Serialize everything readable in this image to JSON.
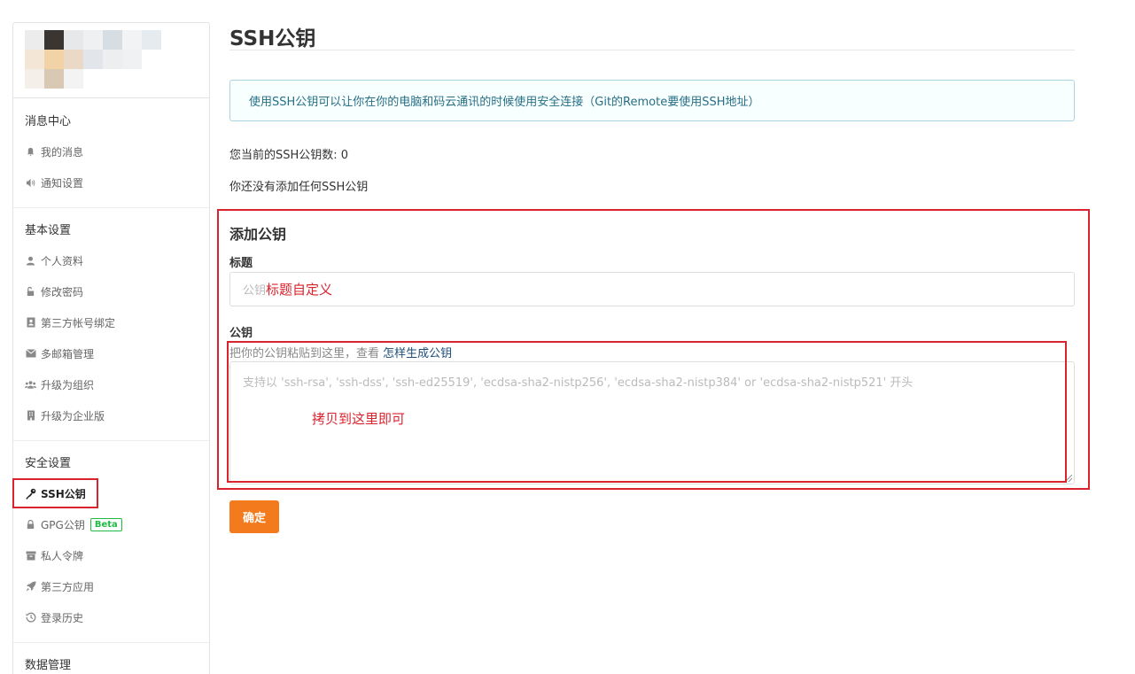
{
  "sidebar": {
    "groups": [
      {
        "title": "消息中心",
        "items": [
          {
            "label": "我的消息",
            "icon": "bell-icon"
          },
          {
            "label": "通知设置",
            "icon": "speaker-icon"
          }
        ]
      },
      {
        "title": "基本设置",
        "items": [
          {
            "label": "个人资料",
            "icon": "user-icon"
          },
          {
            "label": "修改密码",
            "icon": "unlock-icon"
          },
          {
            "label": "第三方帐号绑定",
            "icon": "contact-card-icon"
          },
          {
            "label": "多邮箱管理",
            "icon": "envelope-icon"
          },
          {
            "label": "升级为组织",
            "icon": "users-icon"
          },
          {
            "label": "升级为企业版",
            "icon": "building-icon"
          }
        ]
      },
      {
        "title": "安全设置",
        "items": [
          {
            "label": "SSH公钥",
            "icon": "key-icon",
            "active": true
          },
          {
            "label": "GPG公钥",
            "icon": "lock-icon",
            "badge": "Beta"
          },
          {
            "label": "私人令牌",
            "icon": "archive-icon"
          },
          {
            "label": "第三方应用",
            "icon": "rocket-icon"
          },
          {
            "label": "登录历史",
            "icon": "history-icon"
          }
        ]
      },
      {
        "title": "数据管理",
        "items": []
      }
    ]
  },
  "main": {
    "title": "SSH公钥",
    "info": "使用SSH公钥可以让你在你的电脑和码云通讯的时候使用安全连接（Git的Remote要使用SSH地址）",
    "count_text": "您当前的SSH公钥数: 0",
    "empty_text": "你还没有添加任何SSH公钥",
    "form": {
      "heading": "添加公钥",
      "title_label": "标题",
      "title_placeholder": "公钥",
      "title_annotation": "标题自定义",
      "key_label": "公钥",
      "key_hint": "把你的公钥粘贴到这里，查看",
      "key_hint_link": "怎样生成公钥",
      "key_placeholder": "支持以 'ssh-rsa', 'ssh-dss', 'ssh-ed25519', 'ecdsa-sha2-nistp256', 'ecdsa-sha2-nistp384' or 'ecdsa-sha2-nistp521' 开头",
      "key_annotation": "拷贝到这里即可",
      "submit_label": "确定"
    }
  },
  "colors": {
    "accent_orange": "#f37b1d",
    "annotation_red": "#d9232d",
    "info_text": "#276f86",
    "beta_green": "#21ba45"
  }
}
